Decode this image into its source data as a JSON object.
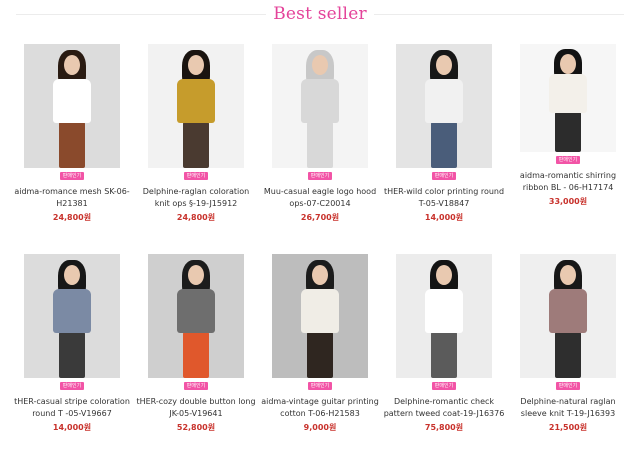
{
  "header": {
    "title": "Best seller"
  },
  "badge_label": "판매인기",
  "products": [
    {
      "name": "aidma-romance mesh SK-06-H21381",
      "price": "24,800원",
      "bg": "#dcdcdc",
      "top": "#ffffff",
      "bottom": "#8a4a2c",
      "hair": "#2a1b12"
    },
    {
      "name": "Delphine-raglan coloration knit ops §-19-J15912",
      "price": "24,800원",
      "bg": "#f2f2f2",
      "top": "#c69c2c",
      "bottom": "#4a3a30",
      "hair": "#1a1410"
    },
    {
      "name": "Muu-casual eagle logo hood ops-07-C20014",
      "price": "26,700원",
      "bg": "#f4f4f4",
      "top": "#d8d8d8",
      "bottom": "#d8d8d8",
      "hair": "#c8c8c8"
    },
    {
      "name": "tHER-wild color printing round T-05-V18847",
      "price": "14,000원",
      "bg": "#e4e4e4",
      "top": "#f1f1f1",
      "bottom": "#4a5d7a",
      "hair": "#171717"
    },
    {
      "name": "aidma-romantic shirring ribbon BL - 06-H17174",
      "price": "33,000원",
      "bg": "#f6f6f6",
      "top": "#f3f0ea",
      "bottom": "#2c2c2c",
      "hair": "#131313"
    },
    {
      "name": "tHER-casual stripe coloration round T -05-V19667",
      "price": "14,000원",
      "bg": "#dcdcdc",
      "top": "#7b8aa4",
      "bottom": "#3a3a3a",
      "hair": "#171717"
    },
    {
      "name": "tHER-cozy double button long JK-05-V19641",
      "price": "52,800원",
      "bg": "#cfcfcf",
      "top": "#6e6e6e",
      "bottom": "#e0582c",
      "hair": "#1c1c1c"
    },
    {
      "name": "aidma-vintage guitar printing cotton T-06-H21583",
      "price": "9,000원",
      "bg": "#bdbdbd",
      "top": "#f0ede6",
      "bottom": "#2f2620",
      "hair": "#1c1c1c"
    },
    {
      "name": "Delphine-romantic check pattern tweed coat-19-J16376",
      "price": "75,800원",
      "bg": "#ececec",
      "top": "#ffffff",
      "bottom": "#5b5b5b",
      "hair": "#141414"
    },
    {
      "name": "Delphine-natural raglan sleeve knit T-19-J16393",
      "price": "21,500원",
      "bg": "#efefef",
      "top": "#9e7b7a",
      "bottom": "#2e2e2e",
      "hair": "#181818"
    }
  ]
}
